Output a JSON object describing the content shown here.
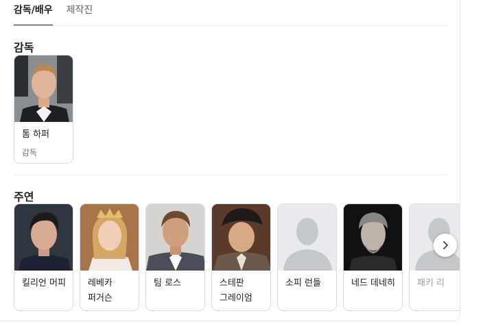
{
  "tabs": [
    {
      "label": "감독/배우",
      "active": true
    },
    {
      "label": "제작진",
      "active": false
    }
  ],
  "sections": {
    "director_title": "감독",
    "cast_title": "주연"
  },
  "director": {
    "name": "톰 하퍼",
    "role": "감독"
  },
  "cast": [
    {
      "name": "킬리언 머피"
    },
    {
      "name": "레베카 퍼거슨"
    },
    {
      "name": "팀 로스"
    },
    {
      "name": "스테판 그레이엄"
    },
    {
      "name": "소피 런들"
    },
    {
      "name": "네드 데네히"
    },
    {
      "name": "패키 리"
    }
  ],
  "icons": {
    "next": "chevron-right-icon",
    "placeholder": "person-placeholder-icon"
  },
  "colors": {
    "accent": "#202124",
    "placeholder_bg": "#e8eaed",
    "placeholder_fg": "#c4c7cc"
  }
}
